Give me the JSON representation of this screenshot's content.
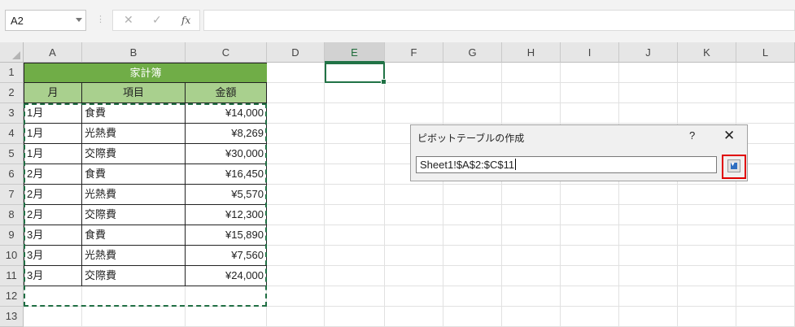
{
  "formula_bar": {
    "name_box": "A2",
    "fx_label": "fx",
    "cancel_icon": "✕",
    "enter_icon": "✓",
    "formula": ""
  },
  "columns": [
    "A",
    "B",
    "C",
    "D",
    "E",
    "F",
    "G",
    "H",
    "I",
    "J",
    "K",
    "L"
  ],
  "rows": [
    "1",
    "2",
    "3",
    "4",
    "5",
    "6",
    "7",
    "8",
    "9",
    "10",
    "11",
    "12",
    "13"
  ],
  "active_column": "E",
  "table": {
    "title": "家計簿",
    "headers": [
      "月",
      "項目",
      "金額"
    ],
    "rows": [
      [
        "1月",
        "食費",
        "¥14,000"
      ],
      [
        "1月",
        "光熱費",
        "¥8,269"
      ],
      [
        "1月",
        "交際費",
        "¥30,000"
      ],
      [
        "2月",
        "食費",
        "¥16,450"
      ],
      [
        "2月",
        "光熱費",
        "¥5,570"
      ],
      [
        "2月",
        "交際費",
        "¥12,300"
      ],
      [
        "3月",
        "食費",
        "¥15,890"
      ],
      [
        "3月",
        "光熱費",
        "¥7,560"
      ],
      [
        "3月",
        "交際費",
        "¥24,000"
      ]
    ]
  },
  "dialog": {
    "title": "ピボットテーブルの作成",
    "help": "?",
    "close": "✕",
    "range_value": "Sheet1!$A$2:$C$11"
  },
  "colors": {
    "title_fill": "#70ad47",
    "header_fill": "#a9d08e",
    "excel_green": "#217346",
    "highlight_red": "#e00000"
  }
}
